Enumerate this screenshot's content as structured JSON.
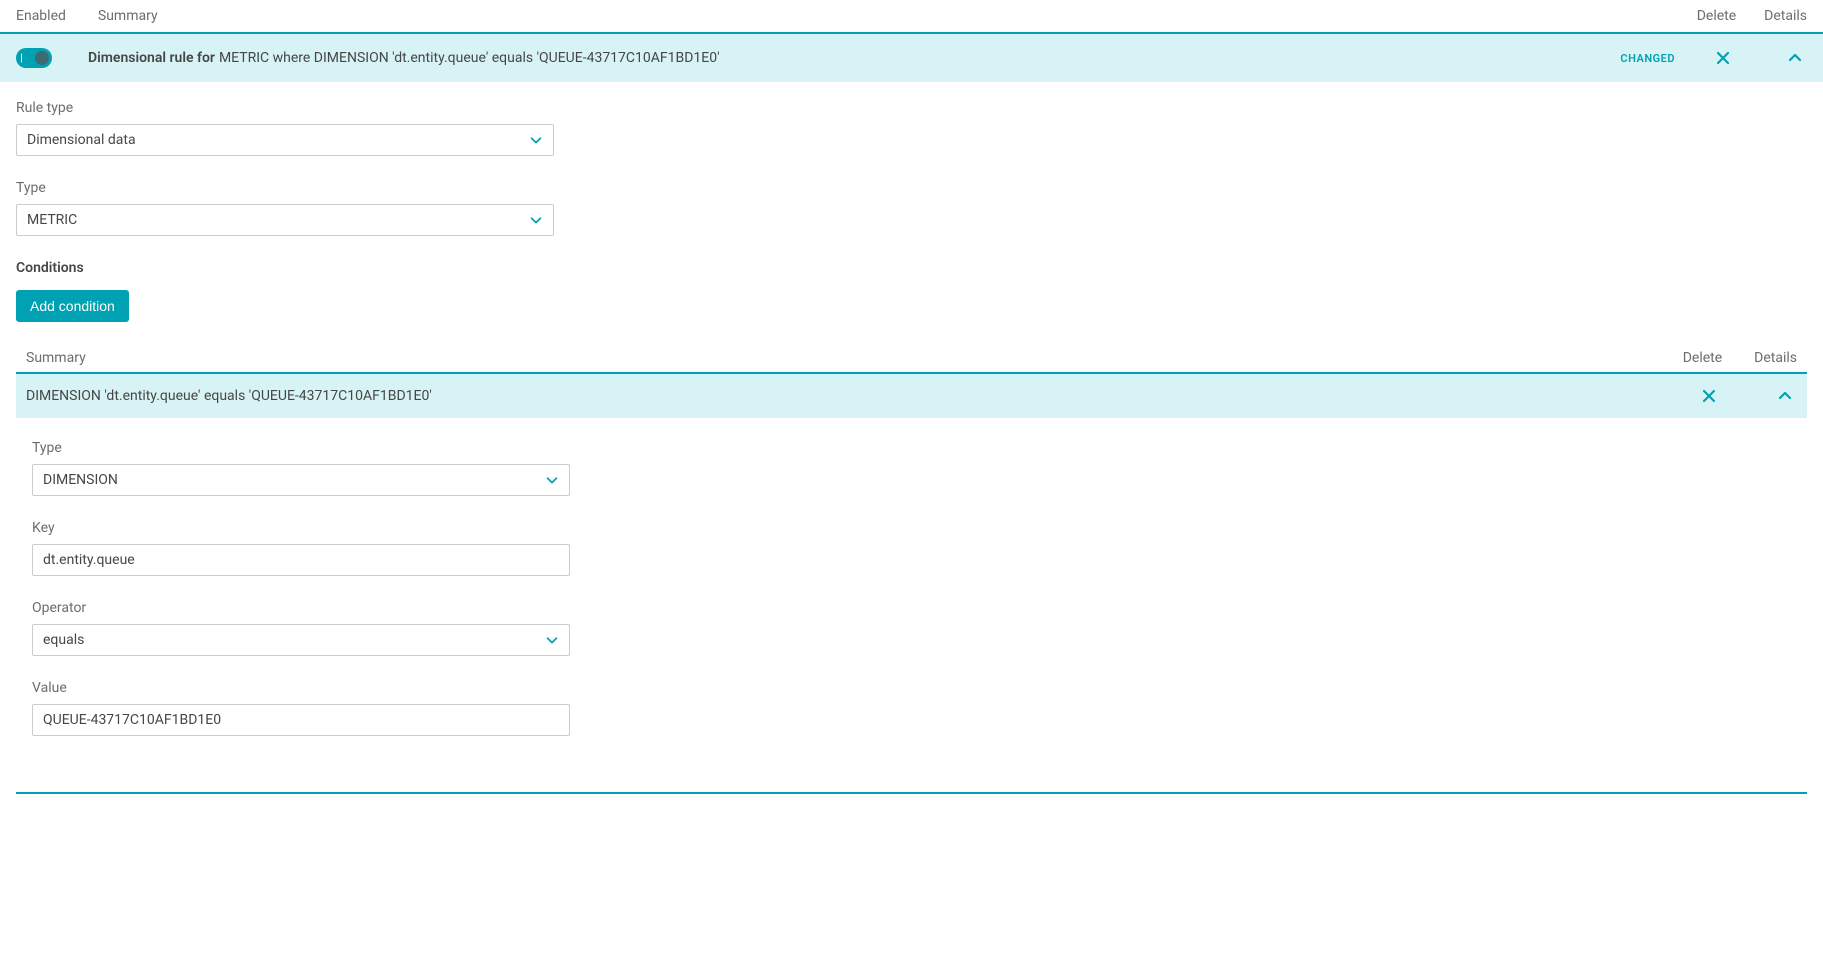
{
  "topHeader": {
    "enabledLabel": "Enabled",
    "summaryLabel": "Summary",
    "deleteLabel": "Delete",
    "detailsLabel": "Details"
  },
  "ruleBar": {
    "titlePrefix": "Dimensional rule for",
    "titleRest": " METRIC where DIMENSION 'dt.entity.queue' equals 'QUEUE-43717C10AF1BD1E0'",
    "changedBadge": "CHANGED"
  },
  "fields": {
    "ruleType": {
      "label": "Rule type",
      "value": "Dimensional data"
    },
    "type": {
      "label": "Type",
      "value": "METRIC"
    }
  },
  "conditions": {
    "sectionTitle": "Conditions",
    "addButton": "Add condition",
    "header": {
      "summary": "Summary",
      "delete": "Delete",
      "details": "Details"
    },
    "item": {
      "summary": "DIMENSION 'dt.entity.queue' equals 'QUEUE-43717C10AF1BD1E0'",
      "type": {
        "label": "Type",
        "value": "DIMENSION"
      },
      "key": {
        "label": "Key",
        "value": "dt.entity.queue"
      },
      "operator": {
        "label": "Operator",
        "value": "equals"
      },
      "value": {
        "label": "Value",
        "value": "QUEUE-43717C10AF1BD1E0"
      }
    }
  }
}
